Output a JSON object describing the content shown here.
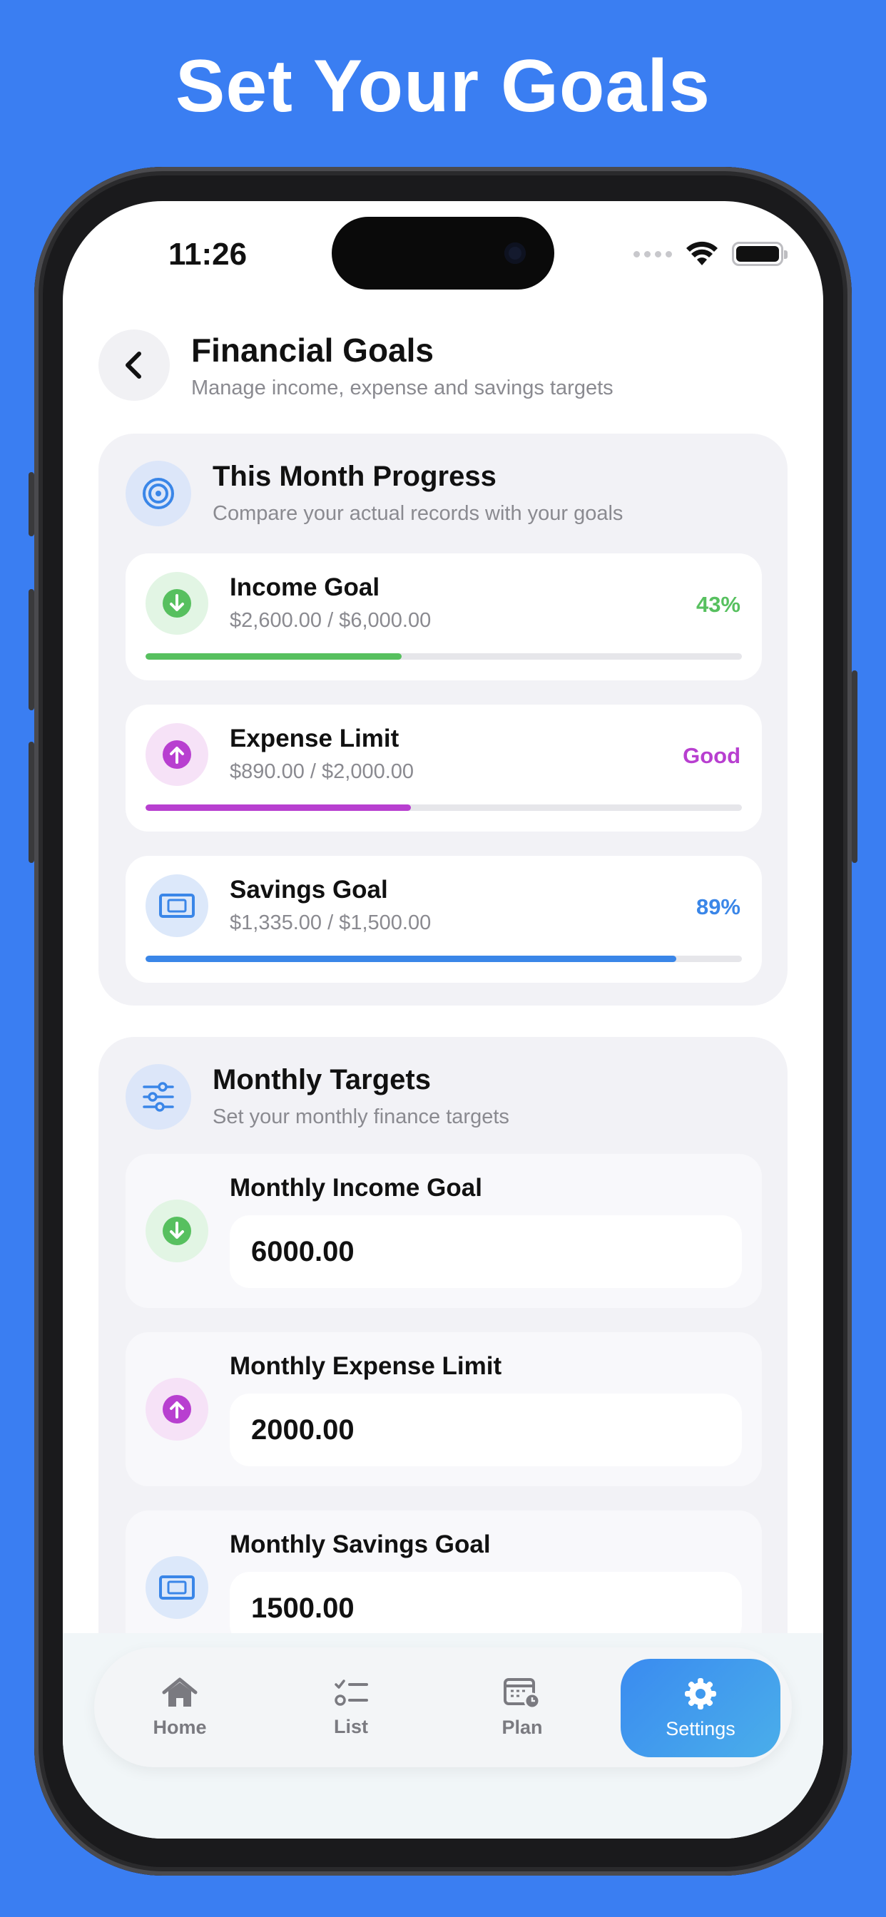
{
  "headline": "Set Your Goals",
  "status": {
    "time": "11:26"
  },
  "header": {
    "title": "Financial Goals",
    "subtitle": "Manage income, expense and savings targets"
  },
  "progress": {
    "title": "This Month Progress",
    "subtitle": "Compare your actual records with your goals",
    "items": [
      {
        "name": "Income Goal",
        "amount": "$2,600.00 / $6,000.00",
        "status": "43%",
        "fraction": 0.43,
        "color": "#57c05f"
      },
      {
        "name": "Expense Limit",
        "amount": "$890.00 / $2,000.00",
        "status": "Good",
        "fraction": 0.445,
        "color": "#b83fd0"
      },
      {
        "name": "Savings Goal",
        "amount": "$1,335.00 / $1,500.00",
        "status": "89%",
        "fraction": 0.89,
        "color": "#3a86e8"
      }
    ]
  },
  "targets": {
    "title": "Monthly Targets",
    "subtitle": "Set your monthly finance targets",
    "items": [
      {
        "label": "Monthly Income Goal",
        "value": "6000.00"
      },
      {
        "label": "Monthly Expense Limit",
        "value": "2000.00"
      },
      {
        "label": "Monthly Savings Goal",
        "value": "1500.00"
      }
    ]
  },
  "tabs": [
    {
      "label": "Home"
    },
    {
      "label": "List"
    },
    {
      "label": "Plan"
    },
    {
      "label": "Settings"
    }
  ],
  "colors": {
    "background": "#3a7ef2",
    "green": "#57c05f",
    "purple": "#b83fd0",
    "blue": "#3a86e8"
  }
}
